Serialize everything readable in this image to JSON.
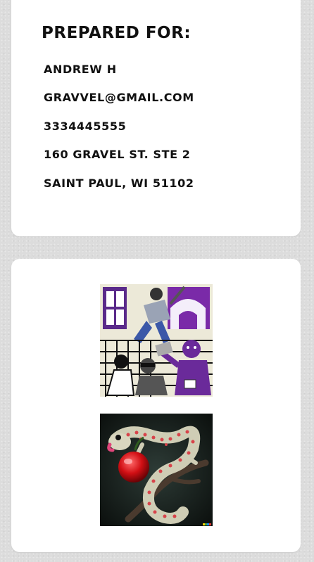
{
  "prepared": {
    "heading": "PREPARED FOR:",
    "name": "ANDREW H",
    "email": "GRAVVEL@GMAIL.COM",
    "phone": "3334445555",
    "address_line1": "160 GRAVEL ST. STE 2",
    "address_line2": "SAINT PAUL, WI 51102"
  },
  "gallery": {
    "images": [
      {
        "icon": "abstract-people-artwork"
      },
      {
        "icon": "gecko-with-cherry-artwork"
      }
    ]
  },
  "colors": {
    "background": "#dcdcdc",
    "card": "#ffffff",
    "text": "#111111",
    "accent_purple": "#6a2a9a"
  }
}
